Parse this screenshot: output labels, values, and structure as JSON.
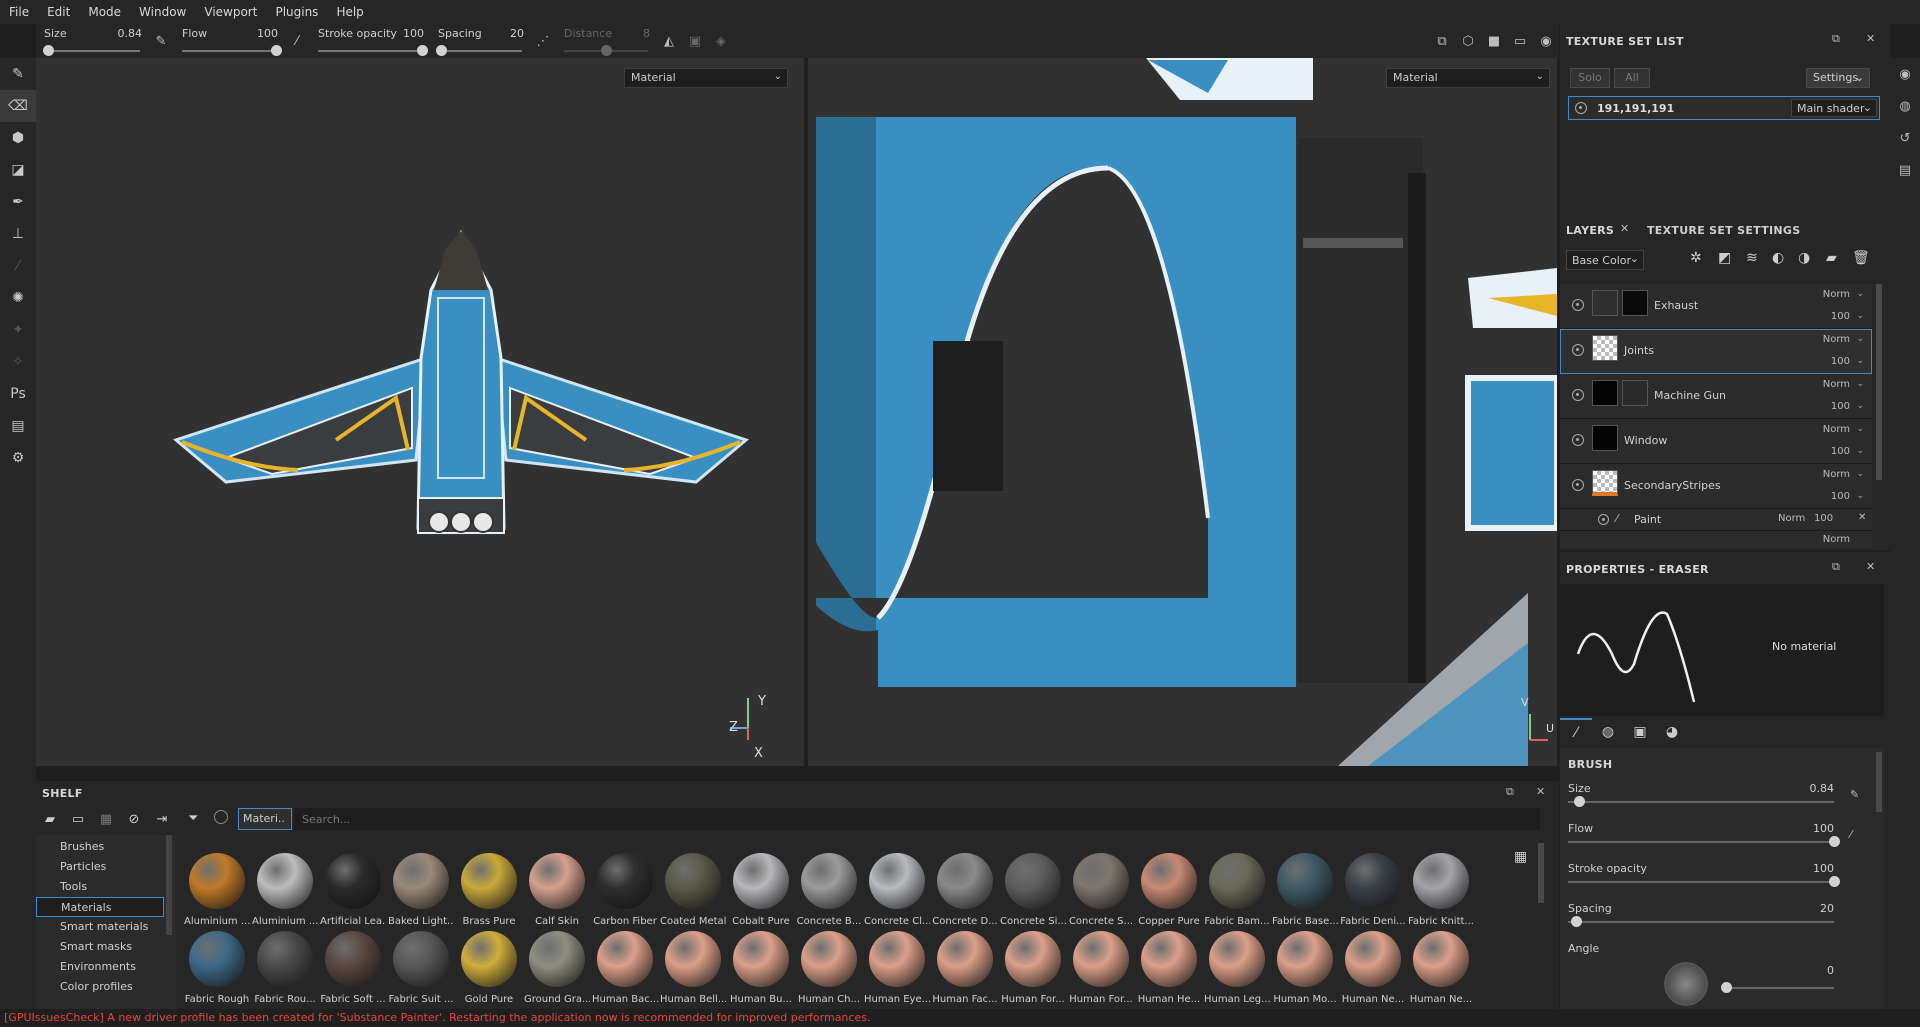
{
  "menu": [
    "File",
    "Edit",
    "Mode",
    "Window",
    "Viewport",
    "Plugins",
    "Help"
  ],
  "toolbar": {
    "size": {
      "label": "Size",
      "value": "0.84",
      "level": 0.04
    },
    "flow": {
      "label": "Flow",
      "value": "100",
      "level": 1.0
    },
    "stroke_opacity": {
      "label": "Stroke opacity",
      "value": "100",
      "level": 1.0
    },
    "spacing": {
      "label": "Spacing",
      "value": "20",
      "level": 0.03
    },
    "distance": {
      "label": "Distance",
      "value": "8",
      "level": 0.5
    }
  },
  "viewport3d": {
    "channel": "Material",
    "axis_y": "Y",
    "axis_z": "Z",
    "axis_x": "X"
  },
  "viewport2d": {
    "channel": "Material",
    "axis_v": "V",
    "axis_u": "U"
  },
  "texture_set_list": {
    "title": "TEXTURE SET LIST",
    "solo": "Solo",
    "all": "All",
    "settings": "Settings",
    "set_name": "191,191,191",
    "shader": "Main shader"
  },
  "layers_panel": {
    "tab_layers": "LAYERS",
    "tab_settings": "TEXTURE SET SETTINGS",
    "channel": "Base Color",
    "layers": [
      {
        "name": "Exhaust",
        "blend": "Norm",
        "opacity": "100"
      },
      {
        "name": "Joints",
        "blend": "Norm",
        "opacity": "100"
      },
      {
        "name": "Machine Gun",
        "blend": "Norm",
        "opacity": "100"
      },
      {
        "name": "Window",
        "blend": "Norm",
        "opacity": "100"
      },
      {
        "name": "SecondaryStripes",
        "blend": "Norm",
        "opacity": "100"
      }
    ],
    "sublayer": {
      "name": "Paint",
      "blend": "Norm",
      "opacity": "100"
    },
    "partial_blend": "Norm"
  },
  "properties": {
    "title": "PROPERTIES - ERASER",
    "no_material": "No material",
    "section": "BRUSH",
    "size": {
      "label": "Size",
      "value": "0.84",
      "level": 0.04
    },
    "flow": {
      "label": "Flow",
      "value": "100",
      "level": 1.0
    },
    "stroke_opacity": {
      "label": "Stroke opacity",
      "value": "100",
      "level": 1.0
    },
    "spacing": {
      "label": "Spacing",
      "value": "20",
      "level": 0.03
    },
    "angle": {
      "label": "Angle",
      "value": "0",
      "level": 0.0
    }
  },
  "shelf": {
    "title": "SHELF",
    "filter_tag": "Materi..",
    "search_placeholder": "Search...",
    "categories": [
      "Brushes",
      "Particles",
      "Tools",
      "Materials",
      "Smart materials",
      "Smart masks",
      "Environments",
      "Color profiles"
    ],
    "materials": [
      {
        "name": "Aluminium ...",
        "color": "#c07a28"
      },
      {
        "name": "Aluminium ...",
        "color": "#bdbdbd"
      },
      {
        "name": "Artificial Lea...",
        "color": "#2a2a2a"
      },
      {
        "name": "Baked Light...",
        "color": "#9a8a7a"
      },
      {
        "name": "Brass Pure",
        "color": "#c9a93a"
      },
      {
        "name": "Calf Skin",
        "color": "#d6a08e"
      },
      {
        "name": "Carbon Fiber",
        "color": "#2e2e2e"
      },
      {
        "name": "Coated Metal",
        "color": "#5a5a48"
      },
      {
        "name": "Cobalt Pure",
        "color": "#b8b8bc"
      },
      {
        "name": "Concrete B...",
        "color": "#9c9c9c"
      },
      {
        "name": "Concrete Cl...",
        "color": "#b8bcc0"
      },
      {
        "name": "Concrete D...",
        "color": "#8a8a8a"
      },
      {
        "name": "Concrete Si...",
        "color": "#5e5e5e"
      },
      {
        "name": "Concrete S...",
        "color": "#7e766c"
      },
      {
        "name": "Copper Pure",
        "color": "#c88a74"
      },
      {
        "name": "Fabric Bam...",
        "color": "#6a6a58"
      },
      {
        "name": "Fabric Base...",
        "color": "#3e5a66"
      },
      {
        "name": "Fabric Deni...",
        "color": "#3a4048"
      },
      {
        "name": "Fabric Knitt...",
        "color": "#a4a4aa"
      },
      {
        "name": "Fabric Rough",
        "color": "#3e6a88"
      },
      {
        "name": "Fabric Rou...",
        "color": "#4a4a4a"
      },
      {
        "name": "Fabric Soft ...",
        "color": "#5a4840"
      },
      {
        "name": "Fabric Suit ...",
        "color": "#585858"
      },
      {
        "name": "Gold Pure",
        "color": "#cfae3c"
      },
      {
        "name": "Ground Gra...",
        "color": "#8e8e80"
      },
      {
        "name": "Human Bac...",
        "color": "#dba08a"
      },
      {
        "name": "Human Bell...",
        "color": "#dba08a"
      },
      {
        "name": "Human Bu...",
        "color": "#dba08a"
      },
      {
        "name": "Human Ch...",
        "color": "#dba08a"
      },
      {
        "name": "Human Eye...",
        "color": "#dba08a"
      },
      {
        "name": "Human Fac...",
        "color": "#dba08a"
      },
      {
        "name": "Human For...",
        "color": "#dba08a"
      },
      {
        "name": "Human For...",
        "color": "#dba08a"
      },
      {
        "name": "Human He...",
        "color": "#dba08a"
      },
      {
        "name": "Human Leg...",
        "color": "#dba08a"
      },
      {
        "name": "Human Mo...",
        "color": "#dba08a"
      },
      {
        "name": "Human Ne...",
        "color": "#dba08a"
      },
      {
        "name": "Human Ne...",
        "color": "#dba08a"
      }
    ]
  },
  "status": {
    "message": "[GPUIssuesCheck] A new driver profile has been created for 'Substance Painter'. Restarting the application now is recommended for improved performances."
  },
  "colors": {
    "accent": "#3c8bd0",
    "ship_blue": "#3a8fc2",
    "stripe_yellow": "#e7b52a",
    "status_red": "#e4483a"
  }
}
